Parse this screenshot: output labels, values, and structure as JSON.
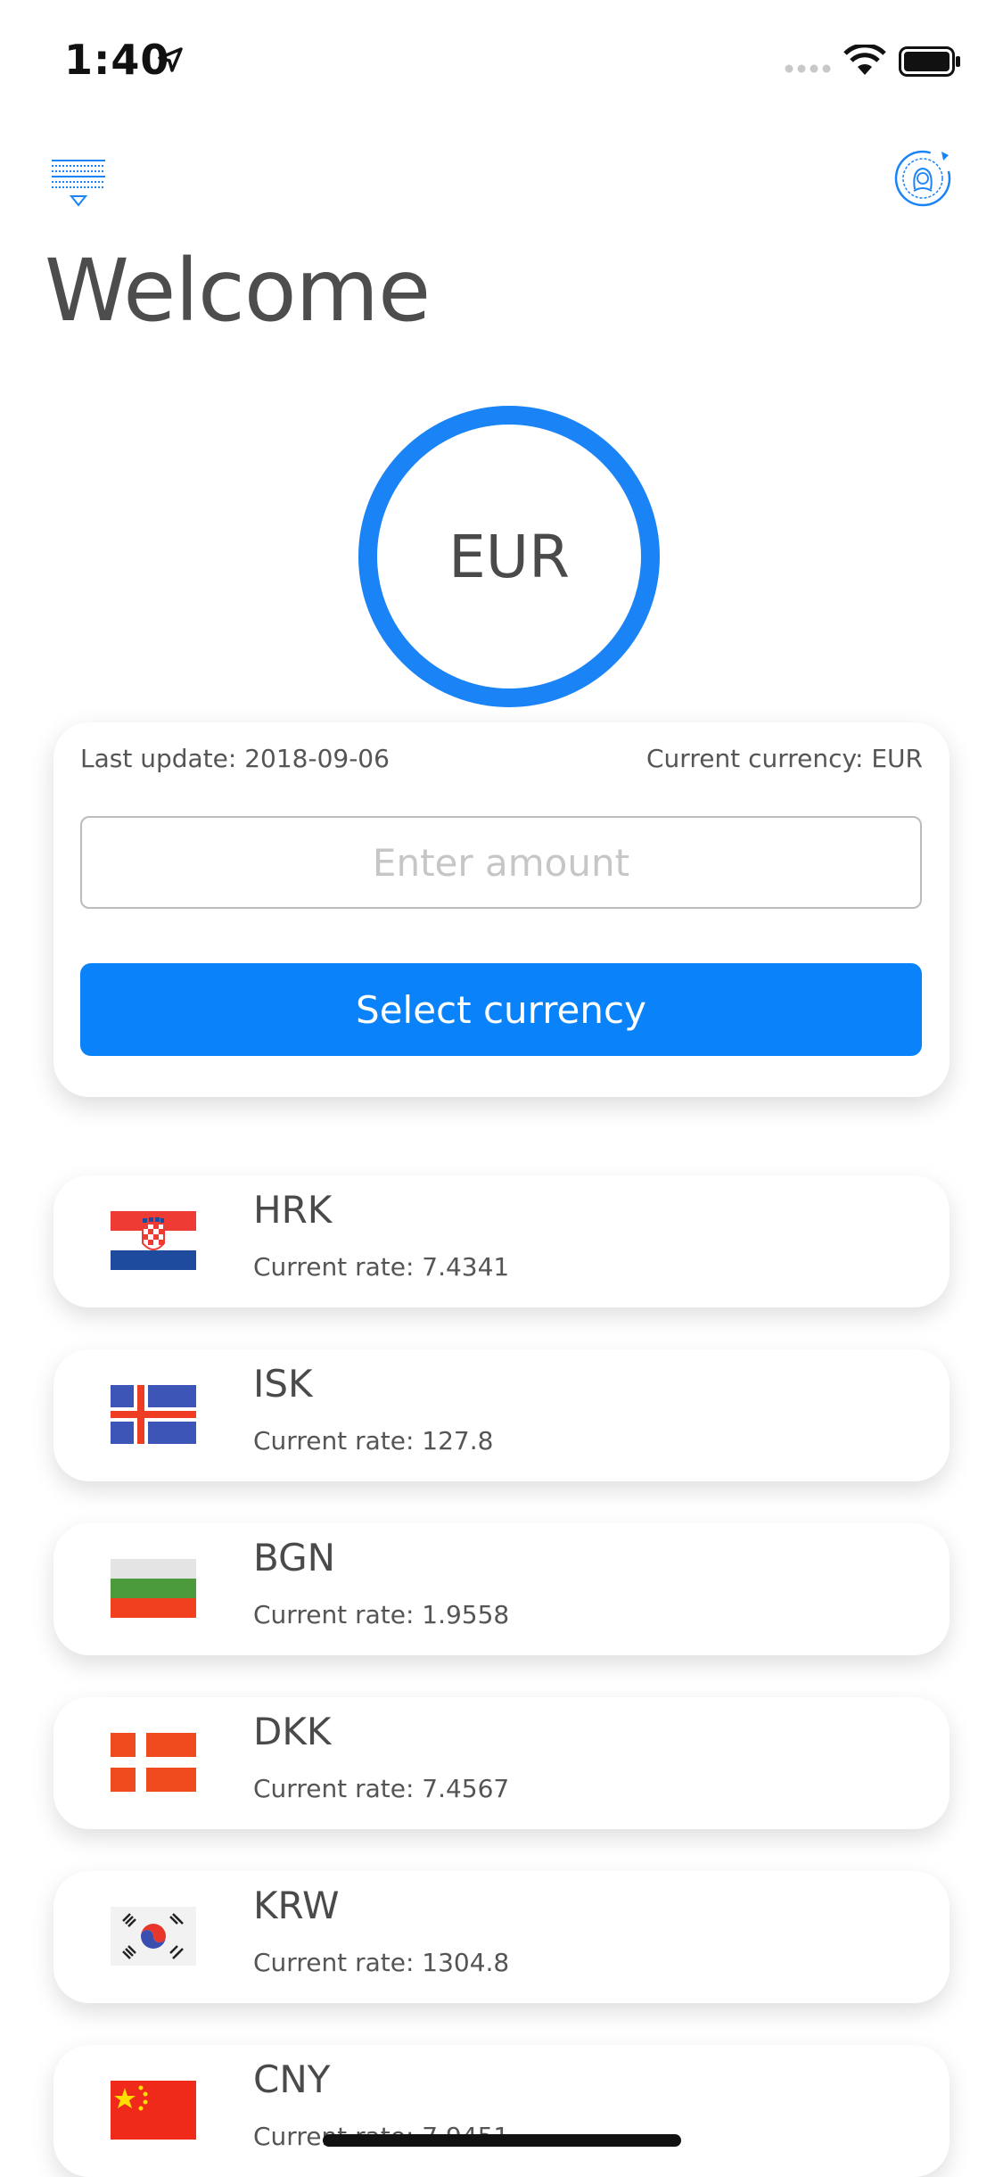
{
  "status_bar": {
    "time": "1:40"
  },
  "header": {
    "title": "Welcome"
  },
  "currency_ring": {
    "label": "EUR"
  },
  "converter": {
    "last_update": "Last update: 2018-09-06",
    "current_currency": "Current currency: EUR",
    "amount_placeholder": "Enter amount",
    "amount_value": "",
    "select_button": "Select currency"
  },
  "rates": [
    {
      "code": "HRK",
      "rate": "Current rate: 7.4341",
      "flag": "croatia-flag"
    },
    {
      "code": "ISK",
      "rate": "Current rate: 127.8",
      "flag": "iceland-flag"
    },
    {
      "code": "BGN",
      "rate": "Current rate: 1.9558",
      "flag": "bulgaria-flag"
    },
    {
      "code": "DKK",
      "rate": "Current rate: 7.4567",
      "flag": "denmark-flag"
    },
    {
      "code": "KRW",
      "rate": "Current rate: 1304.8",
      "flag": "south-korea-flag"
    },
    {
      "code": "CNY",
      "rate": "Current rate: 7.9451",
      "flag": "china-flag"
    }
  ],
  "colors": {
    "accent": "#0a82fa",
    "ring": "#1a84f7",
    "text": "#4a4a4a"
  }
}
